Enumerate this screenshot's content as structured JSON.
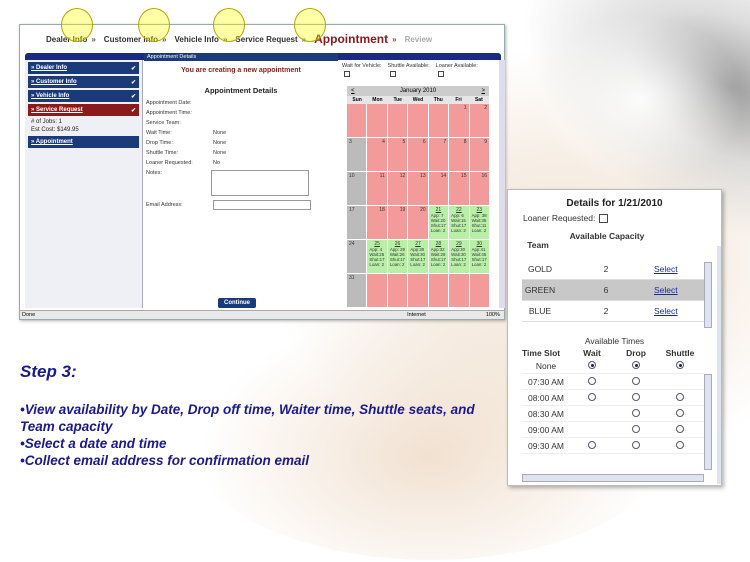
{
  "steps": {
    "dealer": "Dealer Info",
    "customer": "Customer Info",
    "vehicle": "Vehicle Info",
    "service": "Service Request",
    "appointment": "Appointment",
    "review": "Review",
    "sep": "»"
  },
  "sidebar": {
    "items": [
      {
        "label": "» Dealer Info",
        "check": "✔"
      },
      {
        "label": "» Customer Info",
        "check": "✔"
      },
      {
        "label": "» Vehicle Info",
        "check": "✔"
      },
      {
        "label": "» Service Request",
        "check": "✔"
      },
      {
        "label": "» Appointment",
        "check": ""
      }
    ],
    "jobs": "# of Jobs: 1",
    "cost": "Est Cost:  $149.95"
  },
  "form": {
    "header": "Appointment Details",
    "message": "You are creating a new appointment",
    "title": "Appointment Details",
    "fields": [
      {
        "label": "Appointment Date:",
        "value": ""
      },
      {
        "label": "Appointment Time:",
        "value": ""
      },
      {
        "label": "Service Team:",
        "value": ""
      },
      {
        "label": "Wait Time:",
        "value": "None"
      },
      {
        "label": "Drop Time:",
        "value": "None"
      },
      {
        "label": "Shuttle Time:",
        "value": "None"
      },
      {
        "label": "Loaner Requested:",
        "value": "No"
      }
    ],
    "notes_label": "Notes:",
    "email_label": "Email Address:",
    "continue": "Continue"
  },
  "options": {
    "wait": "Wait for Vehicle:",
    "shuttle": "Shuttle Available:",
    "loaner": "Loaner Available:"
  },
  "calendar": {
    "prev": "<",
    "next": ">",
    "month": "January 2010",
    "days": [
      "Sun",
      "Mon",
      "Tue",
      "Wed",
      "Thu",
      "Fri",
      "Sat"
    ],
    "weeks": [
      [
        [
          "",
          ""
        ],
        [
          "",
          ""
        ],
        [
          "",
          ""
        ],
        [
          "",
          ""
        ],
        [
          "",
          ""
        ],
        [
          "1",
          "p"
        ],
        [
          "2",
          "p"
        ]
      ],
      [
        [
          "3",
          "g"
        ],
        [
          "4",
          "p"
        ],
        [
          "5",
          "p"
        ],
        [
          "6",
          "p"
        ],
        [
          "7",
          "p"
        ],
        [
          "8",
          "p"
        ],
        [
          "9",
          "p"
        ]
      ],
      [
        [
          "10",
          "g"
        ],
        [
          "11",
          "p"
        ],
        [
          "12",
          "p"
        ],
        [
          "13",
          "p"
        ],
        [
          "14",
          "p"
        ],
        [
          "15",
          "p"
        ],
        [
          "16",
          "p"
        ]
      ],
      [
        [
          "17",
          "g"
        ],
        [
          "18",
          "p"
        ],
        [
          "19",
          "p"
        ],
        [
          "20",
          "p"
        ],
        [
          "21",
          "a"
        ],
        [
          "22",
          "a"
        ],
        [
          "23",
          "a"
        ]
      ],
      [
        [
          "24",
          "g"
        ],
        [
          "25",
          "a"
        ],
        [
          "26",
          "a"
        ],
        [
          "27",
          "a"
        ],
        [
          "28",
          "a"
        ],
        [
          "29",
          "a"
        ],
        [
          "30",
          "a"
        ]
      ],
      [
        [
          "31",
          "g"
        ],
        [
          "",
          ""
        ],
        [
          "",
          ""
        ],
        [
          "",
          ""
        ],
        [
          "",
          ""
        ],
        [
          "",
          ""
        ],
        [
          "",
          ""
        ]
      ]
    ],
    "avail": {
      "21": [
        "App: 7",
        "Wait:20",
        "Shut:17",
        "Loan: 2"
      ],
      "22": [
        "App: 6",
        "Wait:15",
        "Shut:17",
        "Loan: 2"
      ],
      "23": [
        "App: 38",
        "Wait:35",
        "Shut:11",
        "Loan: 2"
      ],
      "25": [
        "App: 4",
        "Wait:25",
        "Shut:17",
        "Loan: 2"
      ],
      "26": [
        "App: 29",
        "Wait:26",
        "Shut:17",
        "Loan: 2"
      ],
      "27": [
        "App:30",
        "Wait:30",
        "Shut:17",
        "Loan: 2"
      ],
      "28": [
        "App:32",
        "Wait:28",
        "Shut:17",
        "Loan: 2"
      ],
      "29": [
        "App:30",
        "Wait:30",
        "Shut:17",
        "Loan: 2"
      ],
      "30": [
        "App:41",
        "Wait:45",
        "Shut:17",
        "Loan: 2"
      ]
    }
  },
  "status": {
    "left": "Done",
    "zone": "Internet",
    "zoom": "100%"
  },
  "details": {
    "title": "Details for 1/21/2010",
    "loaner": "Loaner Requested:",
    "team_hdr": "Team",
    "cap_hdr": "Available Capacity",
    "teams": [
      {
        "name": "GOLD",
        "cap": "2",
        "action": "Select"
      },
      {
        "name": "GREEN",
        "cap": "6",
        "action": "Select"
      },
      {
        "name": "BLUE",
        "cap": "2",
        "action": "Select"
      }
    ],
    "avail_title": "Available Times",
    "ts_hdr": "Time Slot",
    "wait_hdr": "Wait",
    "drop_hdr": "Drop",
    "shuttle_hdr": "Shuttle",
    "slots": [
      {
        "time": "None",
        "w": "on",
        "d": "on",
        "s": "on"
      },
      {
        "time": "07:30 AM",
        "w": "off",
        "d": "off",
        "s": ""
      },
      {
        "time": "08:00 AM",
        "w": "off",
        "d": "off",
        "s": "off"
      },
      {
        "time": "08:30 AM",
        "w": "",
        "d": "off",
        "s": "off"
      },
      {
        "time": "09:00 AM",
        "w": "",
        "d": "off",
        "s": "off"
      },
      {
        "time": "09:30 AM",
        "w": "off",
        "d": "off",
        "s": "off"
      }
    ]
  },
  "caption": {
    "heading": "Step 3:",
    "bullets": [
      "•View availability by Date, Drop off time, Waiter time, Shuttle seats, and Team capacity",
      "•Select a date and time",
      "•Collect email address for confirmation email"
    ]
  }
}
